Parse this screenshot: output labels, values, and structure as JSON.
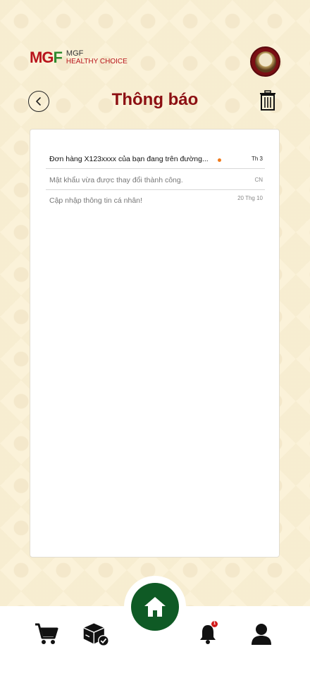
{
  "brand": {
    "logo_mark": "MGF",
    "name": "MGF",
    "tagline": "HEALTHY CHOICE"
  },
  "header": {
    "title": "Thông báo",
    "back_icon": "chevron-left-icon",
    "delete_icon": "trash-icon"
  },
  "notifications": [
    {
      "text": "Đơn hàng X123xxxx của bạn đang trên đường...",
      "date": "Th 3",
      "unread": true
    },
    {
      "text": "Mật khẩu vừa được thay đổi thành công.",
      "date": "CN",
      "unread": false
    },
    {
      "text": "Cập nhập thông tin cá nhân!",
      "date": "20 Thg 10",
      "unread": false
    }
  ],
  "tabbar": {
    "items": [
      "cart-icon",
      "package-check-icon",
      "home-icon",
      "bell-icon",
      "user-icon"
    ],
    "bell_badge": "1"
  },
  "colors": {
    "title": "#8c0f12",
    "home_button": "#0f5a25",
    "unread_dot": "#f07a1c",
    "background": "#fbf2d9"
  }
}
